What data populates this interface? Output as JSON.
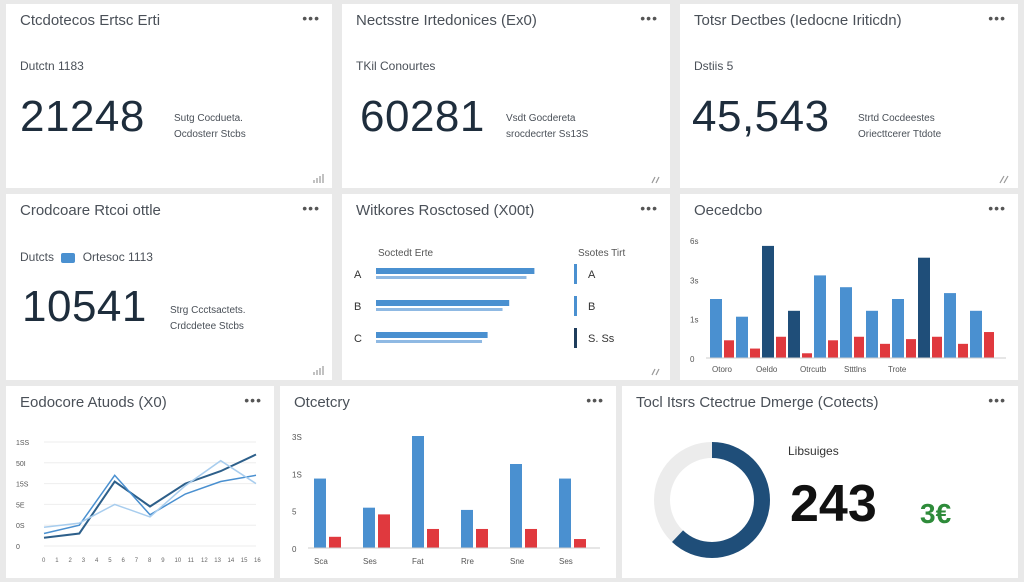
{
  "cards": {
    "c1": {
      "title": "Ctcdotecos Ertsc Erti",
      "sub": "Dutctn 1183",
      "value": "21248",
      "note1": "Sutg Cocdueta.",
      "note2": "Ocdosterr Stcbs"
    },
    "c2": {
      "title": "Nectsstre Irtedonices (Ex0)",
      "sub": "TKil Conourtes",
      "value": "60281",
      "note1": "Vsdt Gocdereta",
      "note2": "srocdecrter Ss13S"
    },
    "c3": {
      "title": "Totsr Dectbes (Iedocne Iriticdn)",
      "sub": "Dstiis 5",
      "value": "45,543",
      "note1": "Strtd Cocdeestes",
      "note2": "Oriecttcerer Ttdote"
    },
    "c4": {
      "title": "Crodcoare Rtcoi ottle",
      "sub_a": "Dutcts",
      "sub_b": "Ortesoc 1113",
      "value": "10541",
      "note1": "Strg Ccctsactets.",
      "note2": "Crdcdetee Stcbs"
    },
    "c5": {
      "title": "Witkores Rosctosed (X00t)"
    },
    "c6": {
      "title": "Oecedcbo"
    },
    "c7": {
      "title": "Eodocore Atuods (X0)"
    },
    "c8": {
      "title": "Otcetcry"
    },
    "c9": {
      "title": "Tocl Itsrs Ctectrue Dmerge (Cotects)"
    }
  },
  "hbar": {
    "header_left": "Soctedt Erte",
    "header_right": "Ssotes Tirt",
    "rows": [
      {
        "label": "A",
        "value": 0.88,
        "right": "A",
        "right_color": "#4a90d0"
      },
      {
        "label": "B",
        "value": 0.74,
        "right": "B",
        "right_color": "#4a90d0"
      },
      {
        "label": "C",
        "value": 0.62,
        "right": "S. Ss",
        "right_color": "#1f3d5c"
      }
    ],
    "colors": {
      "bar": "#4a90d0",
      "line": "#8fb9e3"
    }
  },
  "chart_data": [
    {
      "type": "bar",
      "title": "Oecedcbo",
      "categories": [
        "Otoro",
        "Oeldo",
        "Otrcutb",
        "Stttlns",
        "Trote"
      ],
      "ytick_labels": [
        "6s",
        "3s",
        "1s",
        "0"
      ],
      "series": [
        {
          "values": [
            50,
            35,
            95,
            40,
            70,
            60,
            40,
            50,
            85,
            55,
            40
          ]
        },
        {
          "values": [
            15,
            8,
            18,
            4,
            15,
            18,
            12,
            16,
            18,
            12,
            22
          ]
        }
      ],
      "colors": [
        "#4a90d0",
        "#e0393e"
      ],
      "accent_dark": "#1f4e79"
    },
    {
      "type": "line",
      "title": "Eodocore Atuods (X0)",
      "ytick_labels": [
        "1SS",
        "50I",
        "15S",
        "5E",
        "0S",
        "0"
      ],
      "x_tick_labels": [
        "0",
        "1",
        "2",
        "3",
        "4",
        "5",
        "6",
        "7",
        "8",
        "9",
        "10",
        "11",
        "12",
        "13",
        "14",
        "15",
        "16"
      ],
      "series": [
        {
          "values": [
            8,
            12,
            62,
            38,
            60,
            72,
            88
          ]
        },
        {
          "values": [
            12,
            20,
            68,
            30,
            50,
            62,
            68
          ]
        },
        {
          "values": [
            18,
            22,
            40,
            28,
            58,
            82,
            60
          ]
        }
      ],
      "colors": [
        "#2d5f8a",
        "#4a90d0",
        "#a8cdee"
      ]
    },
    {
      "type": "bar",
      "title": "Otcetcry",
      "categories": [
        "Sca",
        "Ses",
        "Fat",
        "Rre",
        "Sne",
        "Ses"
      ],
      "ytick_labels": [
        "3S",
        "1S",
        "5",
        "0"
      ],
      "series": [
        {
          "values": [
            62,
            36,
            100,
            34,
            75,
            62
          ]
        },
        {
          "values": [
            10,
            30,
            17,
            17,
            17,
            8
          ]
        }
      ],
      "colors": [
        "#4a90d0",
        "#e0393e"
      ]
    }
  ],
  "donut": {
    "label": "Libsuiges",
    "value": "243",
    "delta": "3€",
    "fraction": 0.62,
    "colors": {
      "fill": "#1f4e79",
      "track": "#ececec",
      "delta": "#2e8b3a"
    }
  }
}
